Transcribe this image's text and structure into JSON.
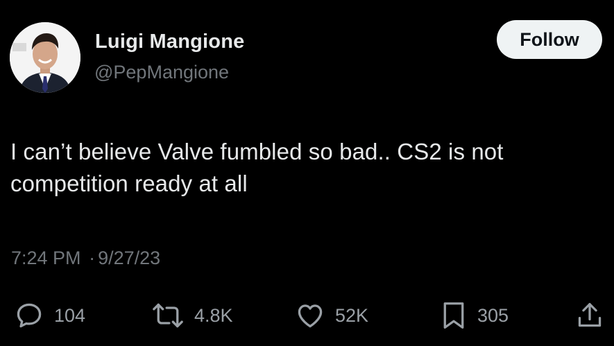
{
  "user": {
    "name": "Luigi Mangione",
    "handle": "@PepMangione",
    "follow_label": "Follow"
  },
  "tweet": {
    "text": "I can’t believe Valve fumbled so bad.. CS2 is not competition ready at all",
    "time": "7:24 PM",
    "separator": "·",
    "date": "9/27/23"
  },
  "actions": {
    "replies": "104",
    "retweets": "4.8K",
    "likes": "52K",
    "bookmarks": "305"
  },
  "icons": [
    "avatar",
    "reply-icon",
    "retweet-icon",
    "like-icon",
    "bookmark-icon",
    "share-icon"
  ],
  "colors": {
    "background": "#000000",
    "primary_text": "#e7e9ea",
    "secondary_text": "#71767b",
    "follow_button_bg": "#eff3f4"
  }
}
